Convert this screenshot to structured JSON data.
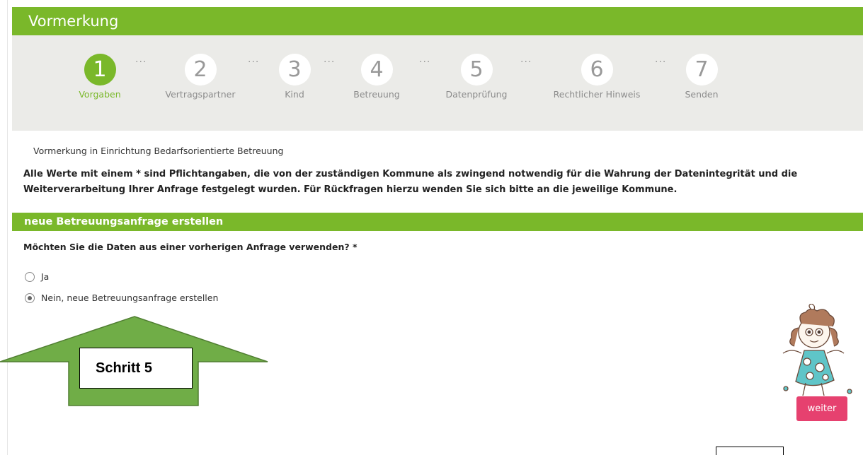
{
  "header": {
    "title": "Vormerkung"
  },
  "steps": [
    {
      "number": "1",
      "label": "Vorgaben",
      "active": true
    },
    {
      "number": "2",
      "label": "Vertragspartner",
      "active": false
    },
    {
      "number": "3",
      "label": "Kind",
      "active": false
    },
    {
      "number": "4",
      "label": "Betreuung",
      "active": false
    },
    {
      "number": "5",
      "label": "Datenprüfung",
      "active": false
    },
    {
      "number": "6",
      "label": "Rechtlicher Hinweis",
      "active": false
    },
    {
      "number": "7",
      "label": "Senden",
      "active": false
    }
  ],
  "step_separator": "···",
  "info": {
    "line": "Vormerkung in Einrichtung Bedarfsorientierte Betreuung",
    "required_note": "Alle Werte mit einem * sind Pflichtangaben, die von der zuständigen Kommune als zwingend notwendig für die Wahrung der Datenintegrität und die Weiterverarbeitung Ihrer Anfrage festgelegt wurden. Für Rückfragen hierzu wenden Sie sich bitte an die jeweilige Kommune."
  },
  "section": {
    "title": "neue Betreuungsanfrage erstellen"
  },
  "question": {
    "text": "Möchten Sie die Daten aus einer vorherigen Anfrage verwenden? *",
    "options": [
      {
        "label": "Ja",
        "checked": false
      },
      {
        "label": "Nein, neue Betreuungsanfrage erstellen",
        "checked": true
      }
    ]
  },
  "annotation": {
    "label": "Schritt 5"
  },
  "actions": {
    "next_label": "weiter"
  },
  "colors": {
    "accent": "#7ab82a",
    "button": "#e6416f",
    "arrow": "#70ad47",
    "stepper_bg": "#ebebe8"
  }
}
